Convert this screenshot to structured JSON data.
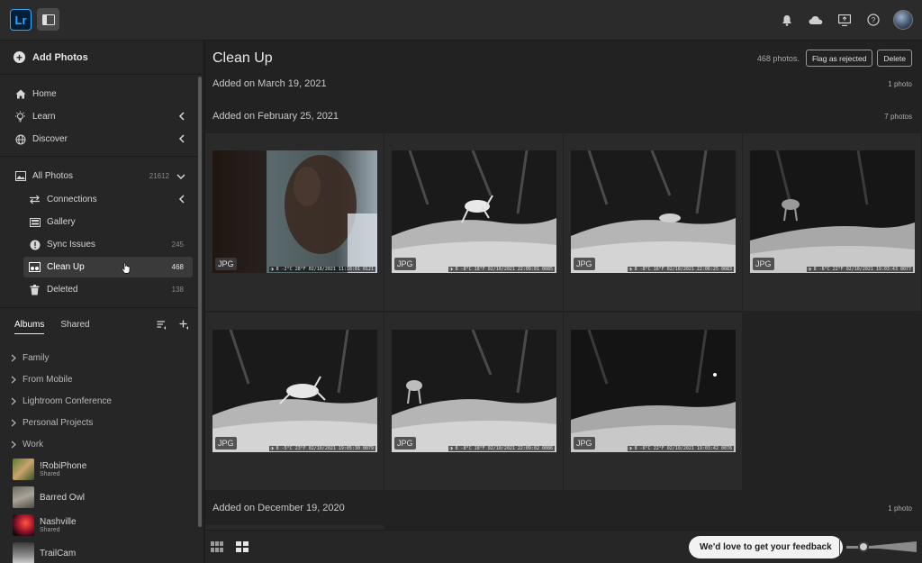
{
  "app": {
    "logo_text": "Lr"
  },
  "topbar": {
    "icons": [
      "bell-icon",
      "cloud-icon",
      "share-screen-icon",
      "help-icon",
      "user-avatar"
    ]
  },
  "sidebar": {
    "add_photos_label": "Add Photos",
    "nav": [
      {
        "label": "Home",
        "icon": "home-icon"
      },
      {
        "label": "Learn",
        "icon": "lightbulb-icon"
      },
      {
        "label": "Discover",
        "icon": "globe-icon"
      }
    ],
    "all_photos": {
      "label": "All Photos",
      "count": "21612"
    },
    "sub_nav": [
      {
        "label": "Connections",
        "count": ""
      },
      {
        "label": "Gallery",
        "count": ""
      },
      {
        "label": "Sync Issues",
        "count": "245"
      },
      {
        "label": "Clean Up",
        "count": "468"
      },
      {
        "label": "Deleted",
        "count": "138"
      }
    ],
    "album_tabs": [
      "Albums",
      "Shared"
    ],
    "folders": [
      "Family",
      "From Mobile",
      "Lightroom Conference",
      "Personal Projects",
      "Work"
    ],
    "albums": [
      {
        "name": "!RobiPhone",
        "sub": "Shared"
      },
      {
        "name": "Barred Owl",
        "sub": ""
      },
      {
        "name": "Nashville",
        "sub": "Shared"
      },
      {
        "name": "TrailCam",
        "sub": ""
      }
    ]
  },
  "main": {
    "title": "Clean Up",
    "photo_count": "468 photos.",
    "flag_button": "Flag as rejected",
    "delete_button": "Delete",
    "sections": [
      {
        "title": "Added on March 19, 2021",
        "count": "1 photo"
      },
      {
        "title": "Added on February 25, 2021",
        "count": "7 photos"
      },
      {
        "title": "Added on December 19, 2020",
        "count": "1 photo"
      }
    ],
    "badge": "JPG",
    "photo_captions": [
      "◑ 8 -2°C 28°F 02/18/2021 11:18:01 0121",
      "◑ 8 -8°C 18°F 02/10/2021 22:09:01 0085",
      "◑ 8 -8°C 16°F 02/10/2021 22:06:25 0083",
      "◑ 8 -6°C 22°F 02/10/2021 19:03:43 0077",
      "◑ 8 -5°C 23°F 02/10/2021 19:05:30 0079",
      "◑ 8 -8°C 18°F 02/10/2021 22:09:02 0086",
      "◑ 8 -6°C 22°F 02/10/2021 19:03:42 0076"
    ]
  },
  "bottombar": {
    "feedback_label": "We'd love to get your feedback",
    "zoom_level": 0.25
  }
}
